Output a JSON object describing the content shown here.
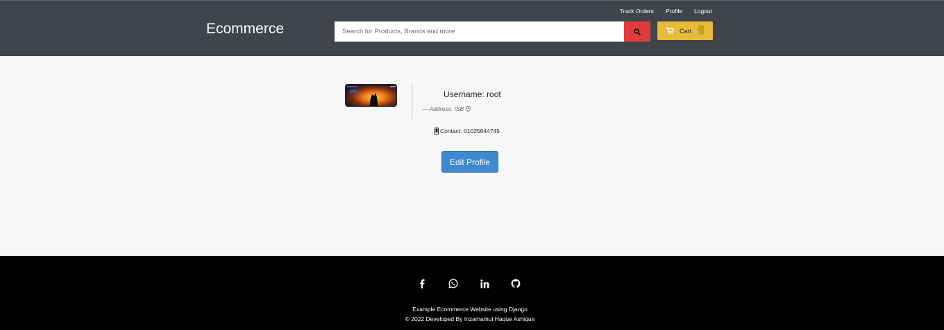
{
  "header": {
    "brand": "Ecommerce",
    "links": [
      "Track Orders",
      "Profile",
      "Logout"
    ],
    "search_placeholder": "Search for Products, Brands and more",
    "cart_label": "Cart"
  },
  "profile": {
    "username": "Username: root",
    "address": "— Address: ISB",
    "contact": "Contact: 01025644745",
    "edit_button": "Edit Profile"
  },
  "footer": {
    "line1": "Example Ecommerce Website using Django",
    "line2": "© 2022 Developed By Inzamamul Haque Ashique",
    "socials": [
      "facebook-icon",
      "whatsapp-icon",
      "linkedin-icon",
      "github-icon"
    ]
  },
  "colors": {
    "header_bg": "#40454b",
    "search_button": "#e33b3b",
    "cart_button": "#e9bb3a",
    "edit_button": "#3e89cf",
    "footer_bg": "#000000"
  }
}
